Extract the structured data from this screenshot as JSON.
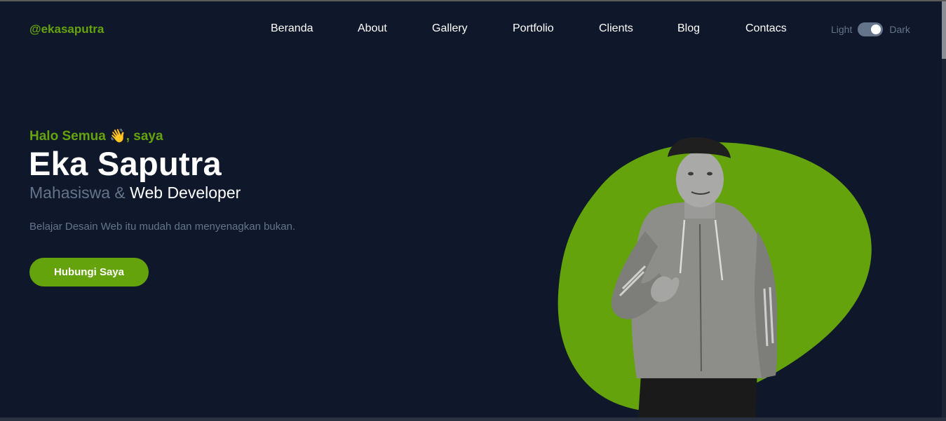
{
  "nav": {
    "logo": "@ekasaputra",
    "links": [
      "Beranda",
      "About",
      "Gallery",
      "Portfolio",
      "Clients",
      "Blog",
      "Contacs"
    ],
    "theme_light": "Light",
    "theme_dark": "Dark",
    "dark_mode_on": true
  },
  "hero": {
    "greeting": "Halo Semua 👋, saya",
    "name": "Eka Saputra",
    "role_primary": "Mahasiswa &",
    "role_secondary": "Web Developer",
    "description": "Belajar Desain Web itu mudah dan menyenagkan bukan.",
    "cta_label": "Hubungi Saya"
  },
  "colors": {
    "background": "#0f172a",
    "accent": "#65a30d",
    "muted": "#64748b",
    "text": "#ffffff"
  }
}
